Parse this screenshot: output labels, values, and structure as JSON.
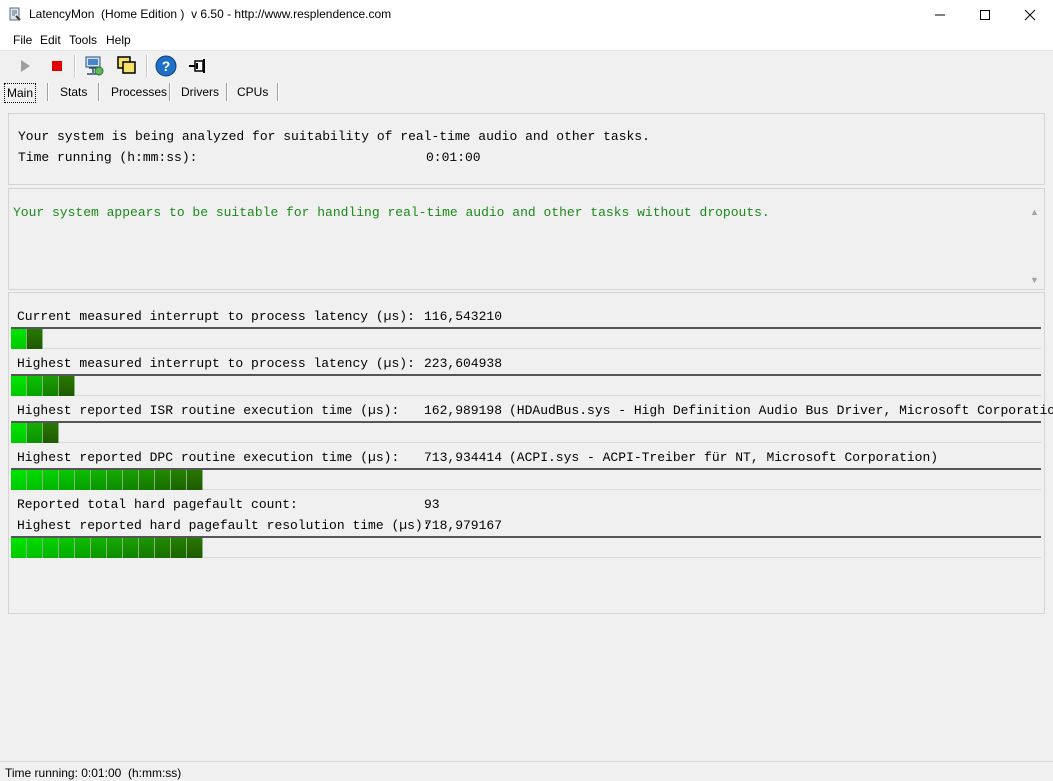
{
  "window": {
    "title": "LatencyMon  (Home Edition )  v 6.50 - http://www.resplendence.com"
  },
  "menu": {
    "items": [
      "File",
      "Edit",
      "Tools",
      "Help"
    ]
  },
  "toolbar": {
    "icons": [
      "play-icon",
      "stop-icon",
      "network-computer-icon",
      "windows-icon",
      "help-icon",
      "pin-icon"
    ]
  },
  "tabs": [
    "Main",
    "Stats",
    "Processes",
    "Drivers",
    "CPUs"
  ],
  "analysis": {
    "line1": "Your system is being analyzed for suitability of real-time audio and other tasks.",
    "time_label": "Time running (h:mm:ss):",
    "time_value": "0:01:00"
  },
  "verdict": {
    "text": "Your system appears to be suitable for handling real-time audio and other tasks without dropouts.",
    "color": "#1a8a1a"
  },
  "metrics": [
    {
      "label": "Current measured interrupt to process latency (µs):",
      "value": "116,543210",
      "note": "",
      "fill_segments": 2
    },
    {
      "label": "Highest measured interrupt to process latency (µs):",
      "value": "223,604938",
      "note": "",
      "fill_segments": 4
    },
    {
      "label": "Highest reported ISR routine execution time (µs):",
      "value": "162,989198",
      "note": "(HDAudBus.sys - High Definition Audio Bus Driver, Microsoft Corporation)",
      "fill_segments": 3
    },
    {
      "label": "Highest reported DPC routine execution time (µs):",
      "value": "713,934414",
      "note": "(ACPI.sys - ACPI-Treiber für NT, Microsoft Corporation)",
      "fill_segments": 12
    },
    {
      "label": "Reported total hard pagefault count:",
      "value": "93",
      "note": ""
    },
    {
      "label": "Highest reported hard pagefault resolution time (µs):",
      "value": "718,979167",
      "note": "",
      "fill_segments": 12
    }
  ],
  "status": {
    "text": "Time running: 0:01:00  (h:mm:ss)"
  }
}
